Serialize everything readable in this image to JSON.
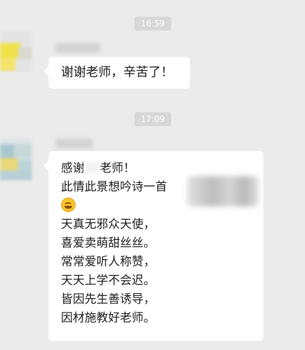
{
  "chat": {
    "timestamps": [
      "16:59",
      "17:09"
    ],
    "message1": {
      "text": "谢谢老师，辛苦了！"
    },
    "message2": {
      "line1_prefix": "感谢",
      "line1_suffix": "老师！",
      "line2": "此情此景想吟诗一首",
      "emoji": "grinning-face-emoji",
      "poem": [
        "天真无邪众天使，",
        "喜爱卖萌甜丝丝。",
        "常常爱听人称赞，",
        "天天上学不会迟。",
        "皆因先生善诱导，",
        "因材施教好老师。"
      ]
    }
  },
  "colors": {
    "background": "#ebebeb",
    "bubble": "#ffffff",
    "timestamp_bg": "#d7d7d7",
    "text": "#1a1a1a"
  }
}
